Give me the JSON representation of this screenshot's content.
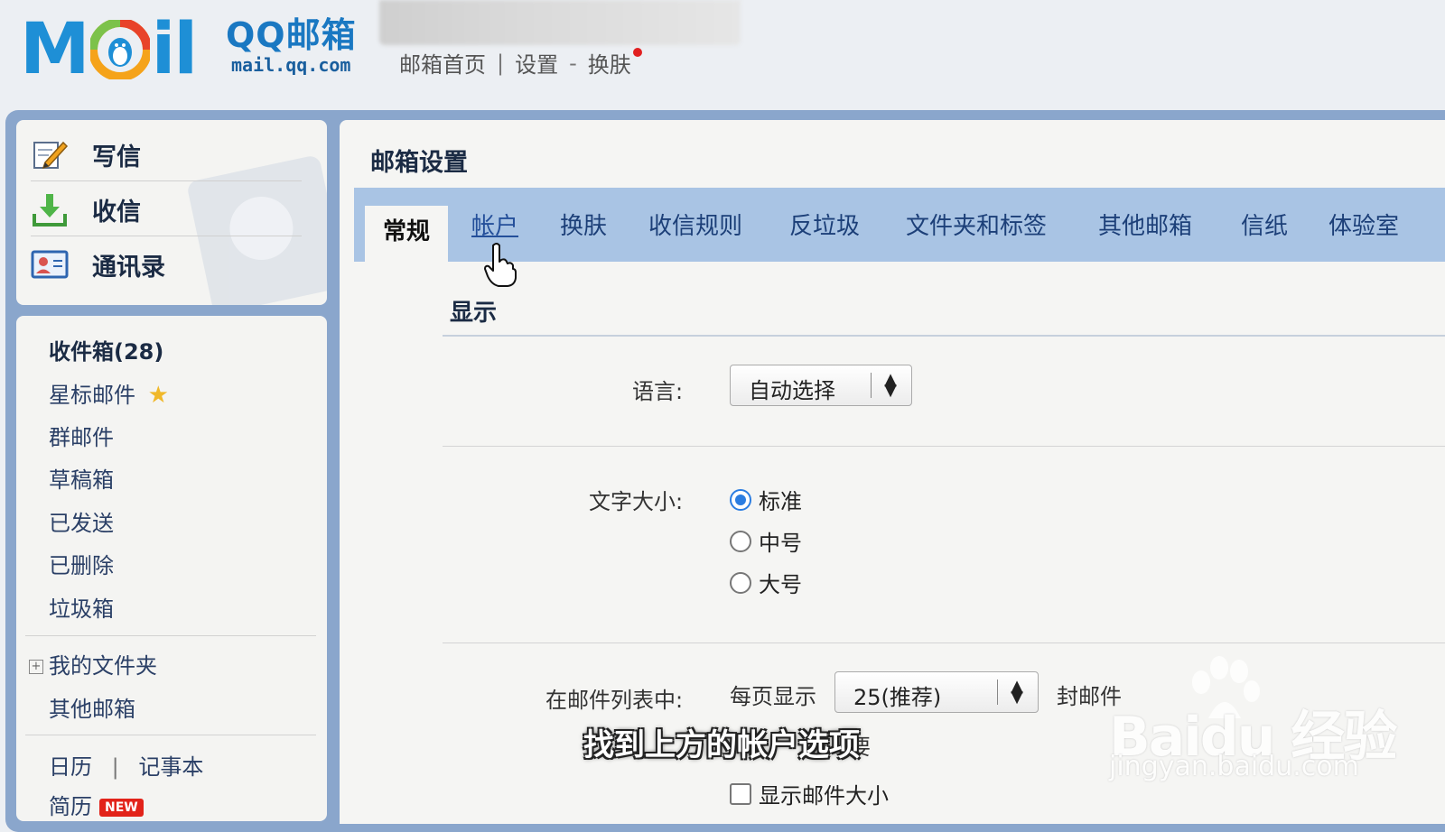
{
  "header": {
    "logo_letters": "Mail",
    "brand_cn": "QQ邮箱",
    "brand_url": "mail.qq.com",
    "links": [
      {
        "label": "邮箱首页"
      },
      {
        "label": "设置"
      },
      {
        "label": "换肤"
      }
    ],
    "link_separator": "|",
    "link_dash": "-"
  },
  "quick_actions": [
    {
      "label": "写信",
      "icon": "pencil-paper-icon"
    },
    {
      "label": "收信",
      "icon": "inbox-download-icon"
    },
    {
      "label": "通讯录",
      "icon": "contact-card-icon"
    }
  ],
  "folders": {
    "inbox": "收件箱(28)",
    "starred": "星标邮件",
    "group": "群邮件",
    "drafts": "草稿箱",
    "sent": "已发送",
    "deleted": "已删除",
    "spam": "垃圾箱",
    "my_folders": "我的文件夹",
    "plus_sign": "+",
    "other_mailboxes": "其他邮箱",
    "calendar": "日历",
    "notepad": "记事本",
    "bottom_sep": "|",
    "resume": "简历",
    "new_badge": "NEW"
  },
  "settings": {
    "title": "邮箱设置",
    "tabs": [
      {
        "label": "常规",
        "active": true
      },
      {
        "label": "帐户",
        "hover": true
      },
      {
        "label": "换肤"
      },
      {
        "label": "收信规则"
      },
      {
        "label": "反垃圾"
      },
      {
        "label": "文件夹和标签"
      },
      {
        "label": "其他邮箱"
      },
      {
        "label": "信纸"
      },
      {
        "label": "体验室"
      }
    ],
    "section_display": "显示",
    "language_label": "语言:",
    "language_value": "自动选择",
    "font_size_label": "文字大小:",
    "font_size_options": [
      {
        "label": "标准",
        "checked": true
      },
      {
        "label": "中号",
        "checked": false
      },
      {
        "label": "大号",
        "checked": false
      }
    ],
    "mail_list_label": "在邮件列表中:",
    "per_page_prefix": "每页显示",
    "per_page_value": "25(推荐)",
    "per_page_suffix": "封邮件",
    "summary_partial": "要",
    "show_size_label": "显示邮件大小"
  },
  "overlay": {
    "subtitle": "找到上方的帐户选项",
    "watermark_main": "Baidu 经验",
    "watermark_sub": "jingyan.baidu.com"
  },
  "colors": {
    "accent_blue": "#1e8fd6",
    "tab_bar": "#a9c4e4",
    "frame": "#8aa6cc",
    "notify_dot": "#e12020",
    "radio_checked": "#2b7de1"
  }
}
